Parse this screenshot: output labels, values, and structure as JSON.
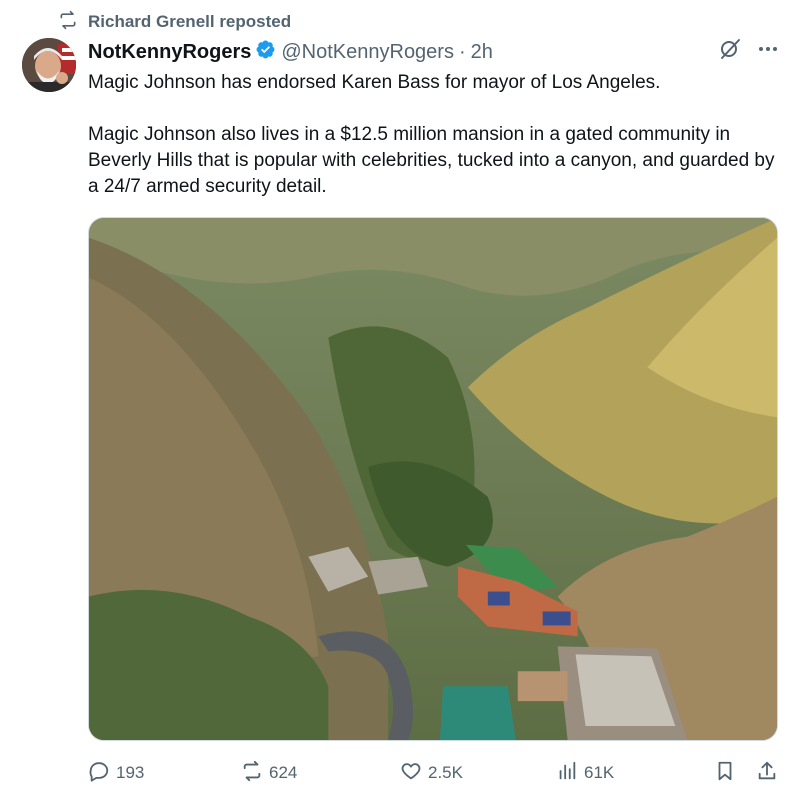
{
  "repost": {
    "label": "Richard Grenell reposted",
    "icon": "repost-icon"
  },
  "author": {
    "display_name": "NotKennyRogers",
    "verified": true,
    "handle": "@NotKennyRogers",
    "separator": "·",
    "time": "2h",
    "verified_color": "#1d9bf0"
  },
  "tweet": {
    "paragraphs": [
      "Magic Johnson has endorsed Karen Bass for mayor of Los Angeles.",
      "Magic Johnson also lives in a $12.5 million mansion in a gated community in Beverly Hills that is popular with celebrities, tucked into a canyon, and guarded by a 24/7 armed security detail."
    ]
  },
  "media": {
    "subject": "aerial photo of a canyon with a mansion, tennis court and pool"
  },
  "actions": {
    "replies": "193",
    "reposts": "624",
    "likes": "2.5K",
    "views": "61K"
  },
  "colors": {
    "secondary_text": "#536471",
    "primary_text": "#0f1419",
    "border": "#cfd9de"
  }
}
